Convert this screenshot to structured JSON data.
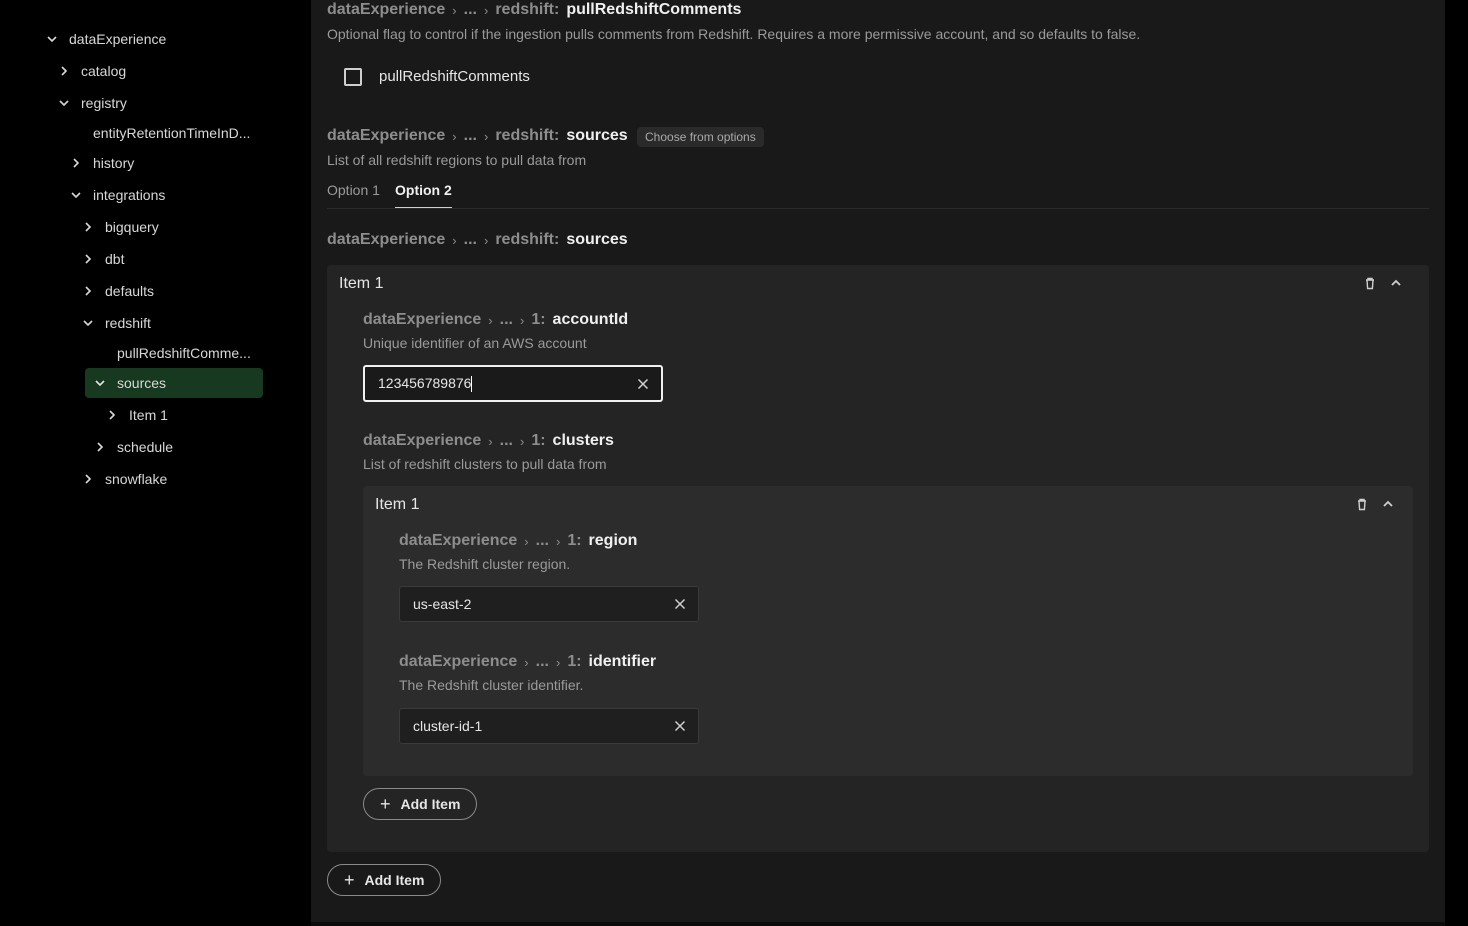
{
  "sidebar": {
    "items": [
      {
        "label": "dataExperience"
      },
      {
        "label": "catalog"
      },
      {
        "label": "registry"
      },
      {
        "label": "entityRetentionTimeInD..."
      },
      {
        "label": "history"
      },
      {
        "label": "integrations"
      },
      {
        "label": "bigquery"
      },
      {
        "label": "dbt"
      },
      {
        "label": "defaults"
      },
      {
        "label": "redshift"
      },
      {
        "label": "pullRedshiftComme..."
      },
      {
        "label": "sources"
      },
      {
        "label": "Item 1"
      },
      {
        "label": "schedule"
      },
      {
        "label": "snowflake"
      }
    ]
  },
  "breadcrumb": {
    "root": "dataExperience",
    "ellipsis": "...",
    "redshift": "redshift",
    "one": "1"
  },
  "pull": {
    "field": "pullRedshiftComments",
    "description": "Optional flag to control if the ingestion pulls comments from Redshift. Requires a more permissive account, and so defaults to false.",
    "checkbox_label": "pullRedshiftComments"
  },
  "sources": {
    "field": "sources",
    "chip": "Choose from options",
    "description": "List of all redshift regions to pull data from",
    "tabs": [
      "Option 1",
      "Option 2"
    ]
  },
  "item": {
    "title": "Item 1",
    "account": {
      "field": "accountId",
      "description": "Unique identifier of an AWS account",
      "value": "123456789876"
    },
    "clusters": {
      "field": "clusters",
      "description": "List of redshift clusters to pull data from"
    },
    "cluster_item": {
      "title": "Item 1",
      "region": {
        "field": "region",
        "description": "The Redshift cluster region.",
        "value": "us-east-2"
      },
      "identifier": {
        "field": "identifier",
        "description": "The Redshift cluster identifier.",
        "value": "cluster-id-1"
      }
    }
  },
  "buttons": {
    "add_item": "Add Item"
  }
}
